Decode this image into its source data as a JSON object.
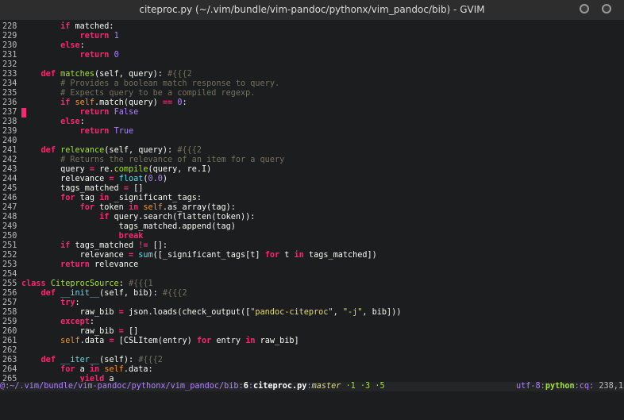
{
  "window": {
    "title": "citeproc.py (~/.vim/bundle/vim-pandoc/pythonx/vim_pandoc/bib) - GVIM",
    "colors": {
      "background": "#1b1d1e",
      "keyword": "#f92672",
      "function": "#a6e22e",
      "number": "#ae81ff",
      "comment": "#75715e",
      "string": "#e6db74",
      "builtin": "#66d9ef"
    }
  },
  "editor": {
    "lines": [
      {
        "n": "228",
        "t": [
          [
            "        ",
            ""
          ],
          [
            "if",
            "k"
          ],
          [
            " matched:",
            ""
          ]
        ]
      },
      {
        "n": "229",
        "t": [
          [
            "            ",
            ""
          ],
          [
            "return",
            "k"
          ],
          [
            " ",
            ""
          ],
          [
            "1",
            "n"
          ]
        ]
      },
      {
        "n": "230",
        "t": [
          [
            "        ",
            ""
          ],
          [
            "else",
            "k"
          ],
          [
            ":",
            ""
          ]
        ]
      },
      {
        "n": "231",
        "t": [
          [
            "            ",
            ""
          ],
          [
            "return",
            "k"
          ],
          [
            " ",
            ""
          ],
          [
            "0",
            "n"
          ]
        ]
      },
      {
        "n": "232",
        "t": []
      },
      {
        "n": "233",
        "t": [
          [
            "    ",
            ""
          ],
          [
            "def",
            "k"
          ],
          [
            " ",
            ""
          ],
          [
            "matches",
            "f"
          ],
          [
            "(self, query): ",
            ""
          ],
          [
            "#{{{2",
            "c"
          ]
        ]
      },
      {
        "n": "234",
        "t": [
          [
            "        ",
            ""
          ],
          [
            "# Provides a boolean match response to query.",
            "c"
          ]
        ]
      },
      {
        "n": "235",
        "t": [
          [
            "        ",
            ""
          ],
          [
            "# Expects query to be a compiled regexp.",
            "c"
          ]
        ]
      },
      {
        "n": "236",
        "t": [
          [
            "        ",
            ""
          ],
          [
            "if",
            "k"
          ],
          [
            " ",
            ""
          ],
          [
            "self",
            "sf"
          ],
          [
            ".match(query) ",
            ""
          ],
          [
            "==",
            "k"
          ],
          [
            " ",
            ""
          ],
          [
            "0",
            "n"
          ],
          [
            ":",
            ""
          ]
        ]
      },
      {
        "n": "237",
        "t": [
          [
            "            ",
            ""
          ],
          [
            "return",
            "k"
          ],
          [
            " ",
            ""
          ],
          [
            "False",
            "n"
          ]
        ],
        "sign": true
      },
      {
        "n": "238",
        "t": [
          [
            "        ",
            ""
          ],
          [
            "else",
            "k"
          ],
          [
            ":",
            ""
          ]
        ]
      },
      {
        "n": "239",
        "t": [
          [
            "            ",
            ""
          ],
          [
            "return",
            "k"
          ],
          [
            " ",
            ""
          ],
          [
            "True",
            "n"
          ]
        ]
      },
      {
        "n": "240",
        "t": []
      },
      {
        "n": "241",
        "t": [
          [
            "    ",
            ""
          ],
          [
            "def",
            "k"
          ],
          [
            " ",
            ""
          ],
          [
            "relevance",
            "f"
          ],
          [
            "(self, query): ",
            ""
          ],
          [
            "#{{{2",
            "c"
          ]
        ]
      },
      {
        "n": "242",
        "t": [
          [
            "        ",
            ""
          ],
          [
            "# Returns the relevance of an item for a query",
            "c"
          ]
        ]
      },
      {
        "n": "243",
        "t": [
          [
            "        query ",
            ""
          ],
          [
            "=",
            "k"
          ],
          [
            " re.",
            ""
          ],
          [
            "compile",
            "f"
          ],
          [
            "(query, re.I)",
            ""
          ]
        ]
      },
      {
        "n": "244",
        "t": [
          [
            "        relevance ",
            ""
          ],
          [
            "=",
            "k"
          ],
          [
            " ",
            ""
          ],
          [
            "float",
            "b"
          ],
          [
            "(",
            ""
          ],
          [
            "0.0",
            "n"
          ],
          [
            ")",
            ""
          ]
        ]
      },
      {
        "n": "245",
        "t": [
          [
            "        tags_matched ",
            ""
          ],
          [
            "=",
            "k"
          ],
          [
            " []",
            ""
          ]
        ]
      },
      {
        "n": "246",
        "t": [
          [
            "        ",
            ""
          ],
          [
            "for",
            "k"
          ],
          [
            " tag ",
            ""
          ],
          [
            "in",
            "k"
          ],
          [
            " _significant_tags:",
            ""
          ]
        ]
      },
      {
        "n": "247",
        "t": [
          [
            "            ",
            ""
          ],
          [
            "for",
            "k"
          ],
          [
            " token ",
            ""
          ],
          [
            "in",
            "k"
          ],
          [
            " ",
            ""
          ],
          [
            "self",
            "sf"
          ],
          [
            ".as_array(tag):",
            ""
          ]
        ]
      },
      {
        "n": "248",
        "t": [
          [
            "                ",
            ""
          ],
          [
            "if",
            "k"
          ],
          [
            " query.search(flatten(token)):",
            ""
          ]
        ]
      },
      {
        "n": "249",
        "t": [
          [
            "                    tags_matched.append(tag)",
            ""
          ]
        ]
      },
      {
        "n": "250",
        "t": [
          [
            "                    ",
            ""
          ],
          [
            "break",
            "k"
          ]
        ]
      },
      {
        "n": "251",
        "t": [
          [
            "        ",
            ""
          ],
          [
            "if",
            "k"
          ],
          [
            " tags_matched ",
            ""
          ],
          [
            "!=",
            "k"
          ],
          [
            " []:",
            ""
          ]
        ]
      },
      {
        "n": "252",
        "t": [
          [
            "            relevance ",
            ""
          ],
          [
            "=",
            "k"
          ],
          [
            " ",
            ""
          ],
          [
            "sum",
            "b"
          ],
          [
            "([_significant_tags[t] ",
            ""
          ],
          [
            "for",
            "k"
          ],
          [
            " t ",
            ""
          ],
          [
            "in",
            "k"
          ],
          [
            " tags_matched])",
            ""
          ]
        ]
      },
      {
        "n": "253",
        "t": [
          [
            "        ",
            ""
          ],
          [
            "return",
            "k"
          ],
          [
            " relevance",
            ""
          ]
        ]
      },
      {
        "n": "254",
        "t": []
      },
      {
        "n": "255",
        "t": [
          [
            "class",
            "k"
          ],
          [
            " ",
            ""
          ],
          [
            "CiteprocSource",
            "f"
          ],
          [
            ": ",
            ""
          ],
          [
            "#{{{1",
            "c"
          ]
        ]
      },
      {
        "n": "256",
        "t": [
          [
            "    ",
            ""
          ],
          [
            "def",
            "k"
          ],
          [
            " ",
            ""
          ],
          [
            "__init__",
            "b"
          ],
          [
            "(self, bib): ",
            ""
          ],
          [
            "#{{{2",
            "c"
          ]
        ]
      },
      {
        "n": "257",
        "t": [
          [
            "        ",
            ""
          ],
          [
            "try",
            "k"
          ],
          [
            ":",
            ""
          ]
        ]
      },
      {
        "n": "258",
        "t": [
          [
            "            raw_bib ",
            ""
          ],
          [
            "=",
            "k"
          ],
          [
            " json.loads(check_output([",
            ""
          ],
          [
            "\"pandoc-citeproc\"",
            "s"
          ],
          [
            ", ",
            ""
          ],
          [
            "\"-j\"",
            "s"
          ],
          [
            ", bib]))",
            ""
          ]
        ]
      },
      {
        "n": "259",
        "t": [
          [
            "        ",
            ""
          ],
          [
            "except",
            "k"
          ],
          [
            ":",
            ""
          ]
        ]
      },
      {
        "n": "260",
        "t": [
          [
            "            raw_bib ",
            ""
          ],
          [
            "=",
            "k"
          ],
          [
            " []",
            ""
          ]
        ]
      },
      {
        "n": "261",
        "t": [
          [
            "        ",
            ""
          ],
          [
            "self",
            "sf"
          ],
          [
            ".data ",
            ""
          ],
          [
            "=",
            "k"
          ],
          [
            " [CSLItem(entry) ",
            ""
          ],
          [
            "for",
            "k"
          ],
          [
            " entry ",
            ""
          ],
          [
            "in",
            "k"
          ],
          [
            " raw_bib]",
            ""
          ]
        ]
      },
      {
        "n": "262",
        "t": []
      },
      {
        "n": "263",
        "t": [
          [
            "    ",
            ""
          ],
          [
            "def",
            "k"
          ],
          [
            " ",
            ""
          ],
          [
            "__iter__",
            "b"
          ],
          [
            "(self): ",
            ""
          ],
          [
            "#{{{2",
            "c"
          ]
        ]
      },
      {
        "n": "264",
        "t": [
          [
            "        ",
            ""
          ],
          [
            "for",
            "k"
          ],
          [
            " a ",
            ""
          ],
          [
            "in",
            "k"
          ],
          [
            " ",
            ""
          ],
          [
            "self",
            "sf"
          ],
          [
            ".data:",
            ""
          ]
        ]
      },
      {
        "n": "265",
        "t": [
          [
            "            ",
            ""
          ],
          [
            "yield",
            "k"
          ],
          [
            " a",
            ""
          ]
        ]
      }
    ]
  },
  "statusline": {
    "path": "@:~/.vim/bundle/vim-pandoc/pythonx/vim_pandoc/bib",
    "sep1": ":",
    "line_count": "6",
    "sep2": ":",
    "filename": "citeproc.py",
    "sep3": ":",
    "branch": "master",
    "stats": " ·1 ·3 ·5",
    "encoding": "utf-8",
    "sep4": ":",
    "filetype": "python",
    "sep5": ":",
    "mode": "cq",
    "sep6": ": ",
    "position": "238,1"
  }
}
